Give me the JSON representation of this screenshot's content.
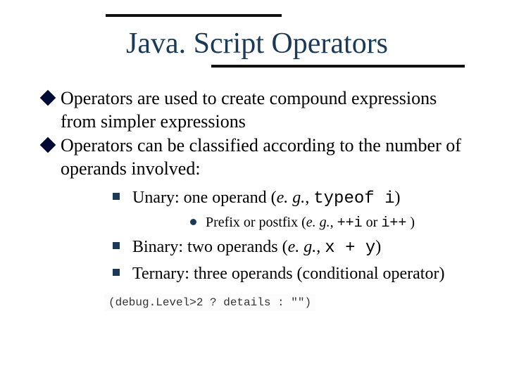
{
  "title": "Java. Script Operators",
  "bullets": {
    "b1": "Operators are used to create compound expressions from simpler expressions",
    "b2": "Operators can be classified according to the number of operands involved:"
  },
  "sub": {
    "unary_pre": "Unary: one operand (",
    "unary_eg": "e. g.",
    "unary_mid": ", ",
    "unary_code": "typeof i",
    "unary_post": ")",
    "prefix_pre": "Prefix or postfix (",
    "prefix_eg": "e. g.",
    "prefix_mid": ", ",
    "prefix_code1": "++i",
    "prefix_or": " or ",
    "prefix_code2": "i++",
    "prefix_post": " )",
    "binary_pre": "Binary: two operands (",
    "binary_eg": "e. g.",
    "binary_mid": ", ",
    "binary_code": "x + y",
    "binary_post": ")",
    "ternary": "Ternary: three operands (conditional operator)"
  },
  "codeimg": "(debug.Level>2 ? details : \"\")"
}
